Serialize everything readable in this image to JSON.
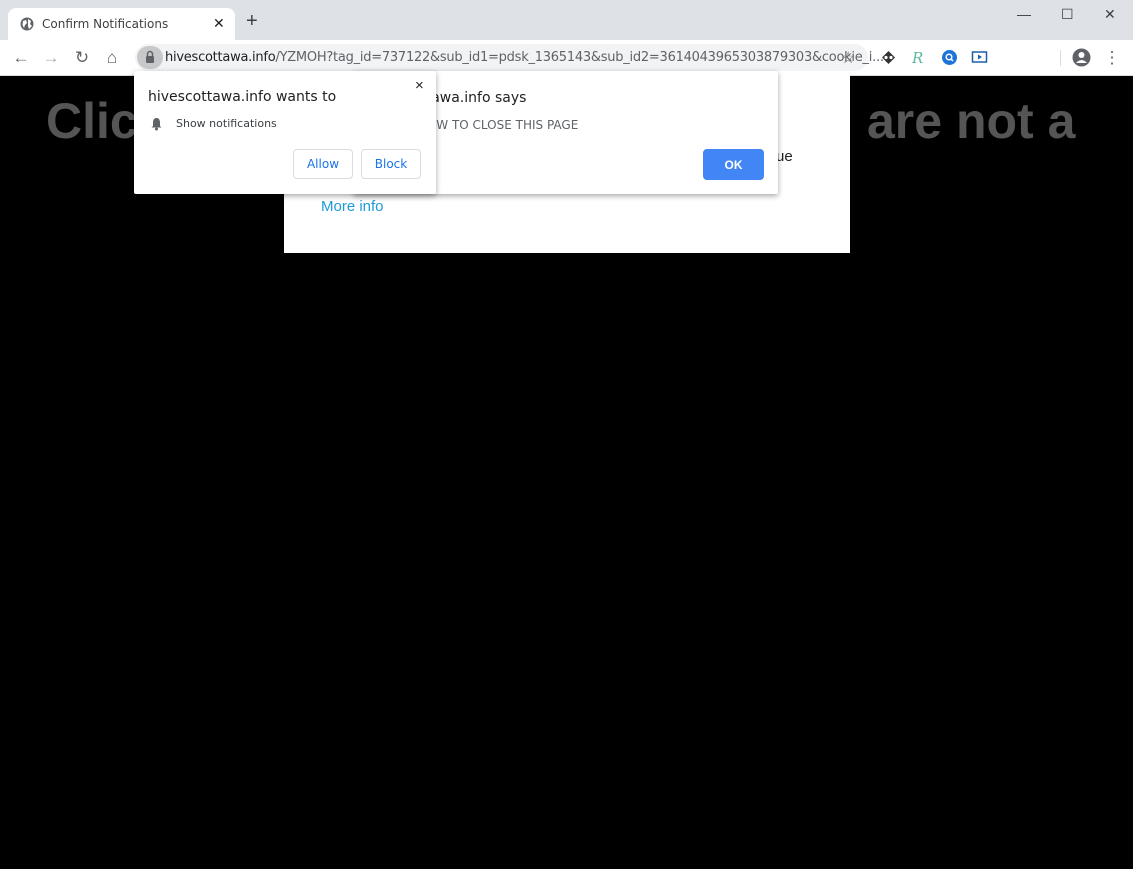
{
  "browser": {
    "tab": {
      "title": "Confirm Notifications",
      "icon": "globe-icon"
    },
    "new_tab_symbol": "+",
    "window_controls": {
      "minimize": "—",
      "maximize": "☐",
      "close": "✕"
    },
    "toolbar": {
      "back": "←",
      "forward": "→",
      "reload": "↻",
      "home": "⌂",
      "url_host": "hivescottawa.info",
      "url_path": "/YZMOH?tag_id=737122&sub_id1=pdsk_1365143&sub_id2=3614043965303879303&cookie_i...",
      "bookmark": "☆",
      "extensions": [
        "tracker-extension-icon",
        "r-extension-icon",
        "search-extension-icon",
        "video-extension-icon"
      ],
      "menu": "⋮"
    }
  },
  "page": {
    "bigtext_left": "Clic",
    "bigtext_right": "are not a",
    "fragment_text": "ue",
    "more_info": "More info",
    "colors": {
      "background": "#000000",
      "bigtext": "#555555",
      "link": "#1d9bd7"
    }
  },
  "alert_dialog": {
    "title": "hivescottawa.info says",
    "message": "CLICK ALLOW TO CLOSE THIS PAGE",
    "ok_label": "OK",
    "ok_color": "#4285f4"
  },
  "permission_prompt": {
    "title": "hivescottawa.info wants to",
    "permission": "Show notifications",
    "allow_label": "Allow",
    "block_label": "Block",
    "close": "×"
  }
}
